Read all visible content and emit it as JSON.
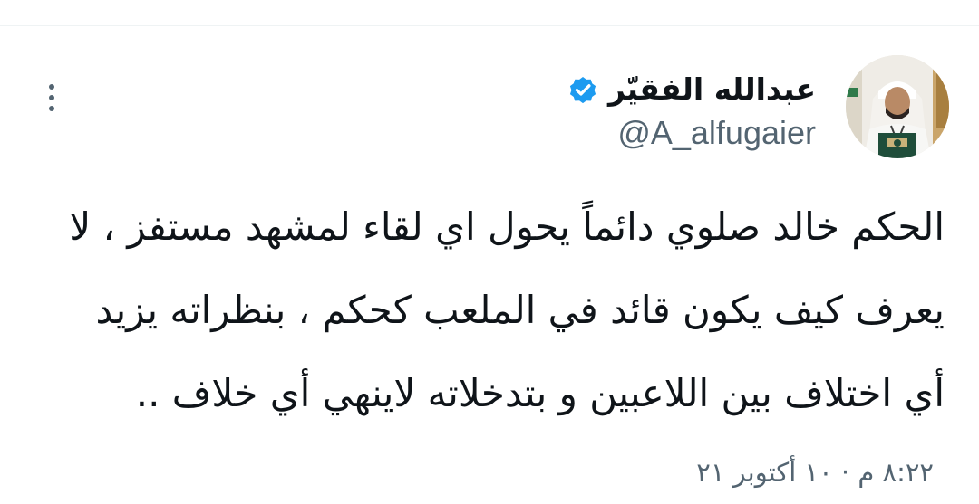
{
  "author": {
    "display_name": "عبدالله الفقيّر",
    "handle": "@A_alfugaier",
    "verified": true,
    "avatar_icon": "profile-photo",
    "verified_icon": "verified-badge-icon",
    "verified_color": "#1d9bf0"
  },
  "tweet": {
    "lines": [
      "الحكم خالد صلوي دائماً يحول اي لقاء لمشهد مستفز ، لا",
      "يعرف كيف يكون قائد في الملعب كحكم ، بنظراته يزيد",
      "أي اختلاف بين اللاعبين و بتدخلاته لاينهي أي خلاف .."
    ],
    "timestamp": "٨:٢٢ م · ١٠ أكتوبر ٢١"
  },
  "menu": {
    "icon": "more-vertical-icon"
  },
  "colors": {
    "text_primary": "#0f1419",
    "text_secondary": "#536471",
    "background": "#ffffff",
    "divider": "#eff3f4"
  }
}
